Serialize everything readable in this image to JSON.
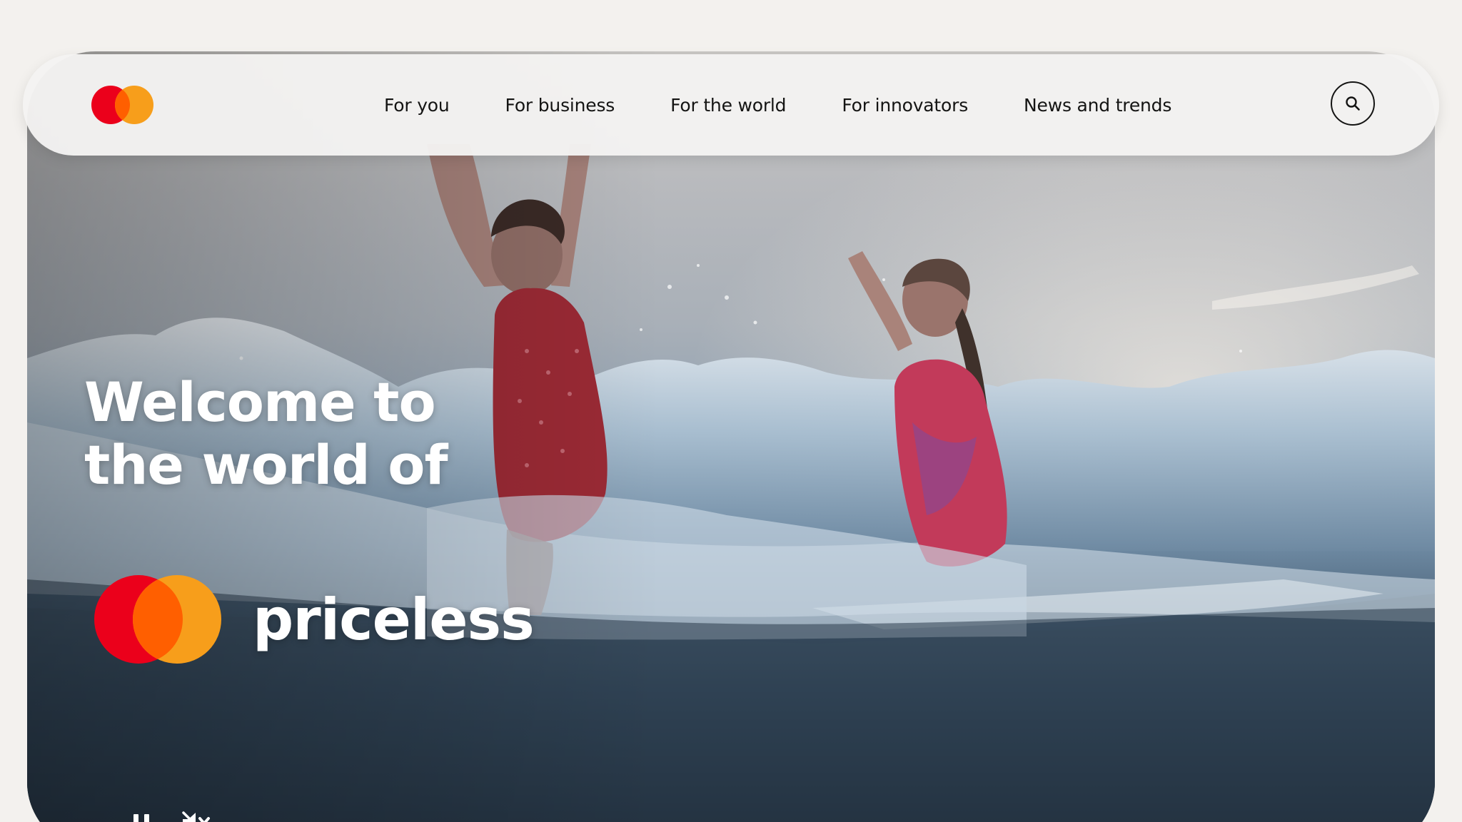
{
  "nav": {
    "logo_name": "mastercard-logo-icon",
    "items": [
      {
        "label": "For you"
      },
      {
        "label": "For business"
      },
      {
        "label": "For the world"
      },
      {
        "label": "For innovators"
      },
      {
        "label": "News and trends"
      }
    ],
    "search_icon": "search-icon"
  },
  "hero": {
    "title_line1": "Welcome to",
    "title_line2": "the world of",
    "lockup_text": "priceless",
    "controls": {
      "pause_icon": "pause-icon",
      "mute_icon": "muted-speaker-icon"
    }
  },
  "colors": {
    "brand_red": "#eb001b",
    "brand_yellow": "#f79e1b",
    "brand_overlap": "#ff5f00",
    "nav_text": "#141413",
    "page_bg": "#f3f1ee"
  }
}
